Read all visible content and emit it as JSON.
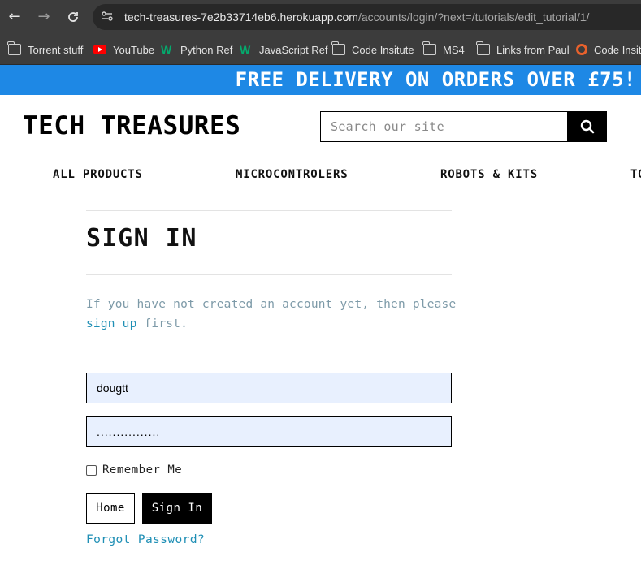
{
  "browser": {
    "url_host": "tech-treasures-7e2b33714eb6.herokuapp.com",
    "url_path": "/accounts/login/?next=/tutorials/edit_tutorial/1/",
    "bookmarks": [
      {
        "label": "Torrent stuff",
        "icon": "folder-icon"
      },
      {
        "label": "YouTube",
        "icon": "youtube-icon"
      },
      {
        "label": "Python Ref",
        "icon": "w3schools-icon"
      },
      {
        "label": "JavaScript Ref",
        "icon": "w3schools-icon"
      },
      {
        "label": "Code Insitute",
        "icon": "folder-icon"
      },
      {
        "label": "MS4",
        "icon": "folder-icon"
      },
      {
        "label": "Links from Paul",
        "icon": "folder-icon"
      },
      {
        "label": "Code Insitu",
        "icon": "code-institute-icon"
      }
    ]
  },
  "banner": {
    "text": "FREE DELIVERY ON ORDERS OVER £75!",
    "color": "#1e88e5"
  },
  "header": {
    "logo": "TECH TREASURES",
    "search_placeholder": "Search our site"
  },
  "nav": {
    "items": [
      "ALL PRODUCTS",
      "MICROCONTROLERS",
      "ROBOTS & KITS",
      "TO"
    ]
  },
  "signin": {
    "title": "SIGN IN",
    "intro_before": "If you have not created an account yet, then please",
    "signup_link": "sign up",
    "intro_after": "first.",
    "username_value": "dougtt",
    "password_value": "................",
    "remember_label": "Remember Me",
    "home_button": "Home",
    "signin_button": "Sign In",
    "forgot_link": "Forgot Password?",
    "link_color": "#1f8fb5"
  }
}
